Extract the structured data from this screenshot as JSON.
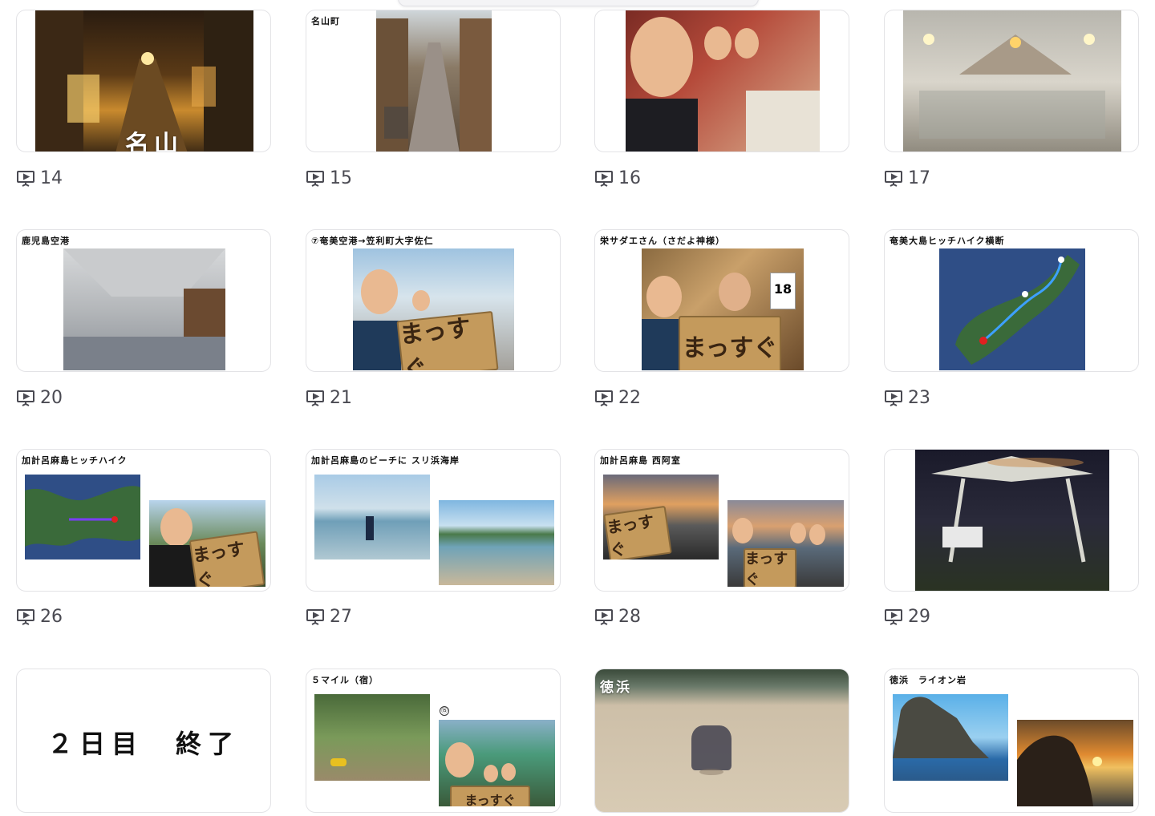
{
  "slides": [
    {
      "num": "14",
      "title": "",
      "overlay": "名山"
    },
    {
      "num": "15",
      "title": "名山町"
    },
    {
      "num": "16",
      "title": ""
    },
    {
      "num": "17",
      "title": ""
    },
    {
      "num": "20",
      "title": "鹿児島空港"
    },
    {
      "num": "21",
      "title": "⑦奄美空港→笠利町大字佐仁",
      "sign": "まっすぐ"
    },
    {
      "num": "22",
      "title": "栄サダエさん（さだよ神様）",
      "sign": "まっすぐ"
    },
    {
      "num": "23",
      "title": "奄美大島ヒッチハイク横断"
    },
    {
      "num": "26",
      "title": "加計呂麻島ヒッチハイク",
      "sign": "まっすぐ"
    },
    {
      "num": "27",
      "title": "加計呂麻島のビーチに スリ浜海岸"
    },
    {
      "num": "28",
      "title": "加計呂麻島 西阿室",
      "sign": "まっすぐ"
    },
    {
      "num": "29",
      "title": ""
    },
    {
      "num": "",
      "title": "",
      "center_text": "２日目　終了"
    },
    {
      "num": "",
      "title": "５マイル（宿）",
      "marker": "⑮",
      "sign": "まっすぐ"
    },
    {
      "num": "",
      "title": "",
      "overlay": "徳浜"
    },
    {
      "num": "",
      "title": "徳浜　ライオン岩"
    }
  ],
  "icons": {
    "slide_num_icon": "presentation-icon"
  },
  "colors": {
    "card_border": "#e3e3e6",
    "num_text": "#4a4a52",
    "background": "#ffffff"
  }
}
